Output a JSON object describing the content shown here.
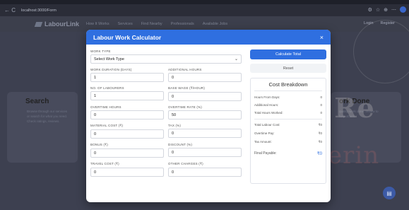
{
  "browser": {
    "nav": "← C",
    "url": "localhost:3000/Form"
  },
  "header": {
    "logo": "LabourLink",
    "nav": [
      "How It Works",
      "Services",
      "Find Nearby",
      "Professionals",
      "Available Jobs"
    ],
    "login": "Login",
    "register": "Register"
  },
  "background": {
    "left_title": "Search",
    "left_desc": "Browse through our services or search for what you need. Check ratings, reviews.",
    "right_title": "ork Done",
    "right_desc": "quality work done. review to help others.",
    "watermark_top": "Global Re",
    "watermark_bottom": "in Engineerin"
  },
  "modal": {
    "title": "Labour Work Calculator",
    "close": "×",
    "work_type": {
      "label": "WORK TYPE",
      "value": "Select Work Type"
    },
    "fields": [
      [
        {
          "label": "WORK DURATION (DAYS)",
          "value": "1"
        },
        {
          "label": "ADDITIONAL HOURS",
          "value": "0"
        }
      ],
      [
        {
          "label": "NO. OF LABOURERS",
          "value": "1"
        },
        {
          "label": "BASE WAGE (₹/HOUR)",
          "value": "0"
        }
      ],
      [
        {
          "label": "OVERTIME HOURS",
          "value": "0"
        },
        {
          "label": "OVERTIME RATE (%)",
          "value": "50"
        }
      ],
      [
        {
          "label": "MATERIAL COST (₹)",
          "value": "0"
        },
        {
          "label": "TAX (%)",
          "value": "0"
        }
      ],
      [
        {
          "label": "BONUS (₹)",
          "value": "0"
        },
        {
          "label": "DISCOUNT (%)",
          "value": "0"
        }
      ],
      [
        {
          "label": "TRAVEL COST (₹)",
          "value": "0"
        },
        {
          "label": "OTHER CHARGES (₹)",
          "value": "0"
        }
      ]
    ],
    "calculate": "Calculate Total",
    "reset": "Reset",
    "breakdown": {
      "title": "Cost Breakdown",
      "rows": [
        {
          "label": "Hours From Days:",
          "value": "0"
        },
        {
          "label": "Additional Hours:",
          "value": "0"
        },
        {
          "label": "Total Hours Worked:",
          "value": "0"
        },
        {
          "label": "Total Labour Cost:",
          "value": "₹0"
        },
        {
          "label": "Overtime Pay:",
          "value": "₹0"
        },
        {
          "label": "Tax Amount:",
          "value": "₹0"
        }
      ],
      "final_label": "Final Payable:",
      "final_value": "₹0"
    }
  }
}
